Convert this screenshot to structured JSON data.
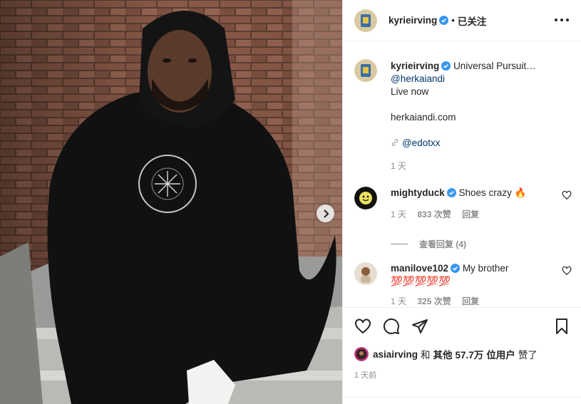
{
  "post": {
    "author": "kyrieirving",
    "follow_state": "已关注",
    "separator": "•"
  },
  "caption": {
    "username": "kyrieirving",
    "line1_text": "Universal Pursuit…",
    "mention": "@herkaiandi",
    "line2": "Live now",
    "website": "herkaiandi.com",
    "tag_mention": "@edotxx",
    "time": "1 天"
  },
  "comments": [
    {
      "username": "mightyduck",
      "text": "Shoes crazy",
      "emoji": "🔥",
      "time": "1 天",
      "likes": "833 次赞",
      "reply_label": "回复",
      "view_replies": "查看回复 (4)"
    },
    {
      "username": "manilove102",
      "text": "My brother",
      "emoji_line": "💯💯💯💯💯",
      "time": "1 天",
      "likes": "325 次赞",
      "reply_label": "回复"
    }
  ],
  "likes": {
    "first_user": "asiairving",
    "connector": "和",
    "others_label": "其他",
    "count": "57.7万",
    "suffix": "位用户",
    "action": "赞了"
  },
  "time_ago": "1 天前",
  "icons": {
    "like": "heart-icon",
    "comment": "comment-bubble-icon",
    "share": "paper-plane-icon",
    "save": "bookmark-icon",
    "next": "chevron-right-icon",
    "verified": "verified-badge-icon",
    "more": "more-options-icon"
  },
  "colors": {
    "verified": "#3897f0",
    "link": "#00376b",
    "muted": "#8e8e8e"
  }
}
